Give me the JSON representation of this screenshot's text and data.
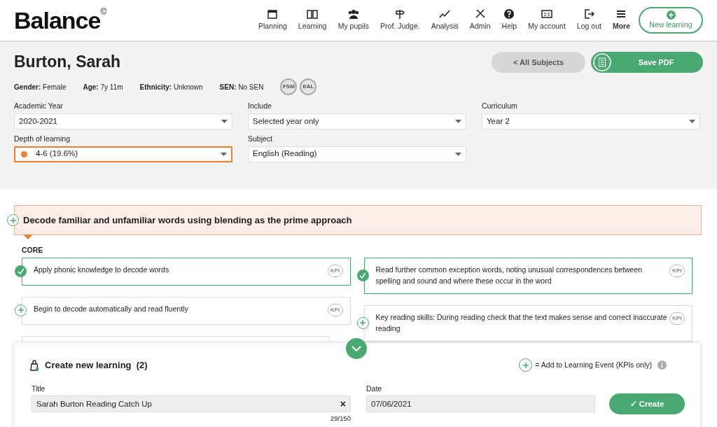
{
  "logo": {
    "text": "Balance",
    "mark": "©"
  },
  "nav": [
    {
      "label": "Planning"
    },
    {
      "label": "Learning"
    },
    {
      "label": "My pupils"
    },
    {
      "label": "Prof. Judge."
    },
    {
      "label": "Analysis"
    },
    {
      "label": "Admin"
    },
    {
      "label": "Help"
    },
    {
      "label": "My account"
    },
    {
      "label": "Log out"
    },
    {
      "label": "More",
      "selected": true
    }
  ],
  "new_learning_button": "New learning",
  "pupil": {
    "name": "Burton, Sarah",
    "details": [
      {
        "label": "Gender:",
        "value": "Female"
      },
      {
        "label": "Age:",
        "value": "7y 11m"
      },
      {
        "label": "Ethnicity:",
        "value": "Unknown"
      },
      {
        "label": "SEN:",
        "value": "No SEN"
      }
    ],
    "badges": [
      "FSM",
      "EAL"
    ]
  },
  "all_subjects_button": "< All Subjects",
  "save_pdf_button": "Save PDF",
  "filters": [
    {
      "label": "Academic Year",
      "value": "2020-2021"
    },
    {
      "label": "Include",
      "value": "Selected year only"
    },
    {
      "label": "Curriculum",
      "value": "Year 2"
    },
    {
      "label": "Depth of learning",
      "value": "4-6 (19.6%)",
      "color": "#f08030",
      "highlighted": true
    },
    {
      "label": "Subject",
      "value": "English (Reading)"
    }
  ],
  "objective": {
    "title": "Decode familiar and unfamiliar words using blending as the prime approach",
    "section": "CORE",
    "items": [
      {
        "text": "Apply phonic knowledge to decode words",
        "checked": true,
        "badge": "KPI"
      },
      {
        "text": "Read further common exception words, noting unusual correspondences between spelling and sound and where these occur in the word",
        "checked": true,
        "badge": "KPI"
      },
      {
        "text": "Begin to decode automatically and read fluently",
        "checked": false,
        "badge": "KPI"
      },
      {
        "text": "Key reading skills: During reading check that the text makes sense and correct inaccurate reading",
        "checked": false,
        "badge": "KPI"
      }
    ]
  },
  "create_panel": {
    "title": "Create new learning",
    "count": "(2)",
    "legend": "= Add to Learning Event (KPIs only)",
    "title_label": "Title",
    "title_value": "Sarah Burton Reading Catch Up",
    "clear": "×",
    "char_count": "29/150",
    "date_label": "Date",
    "date_value": "07/06/2021",
    "create_button": "✓ Create"
  }
}
